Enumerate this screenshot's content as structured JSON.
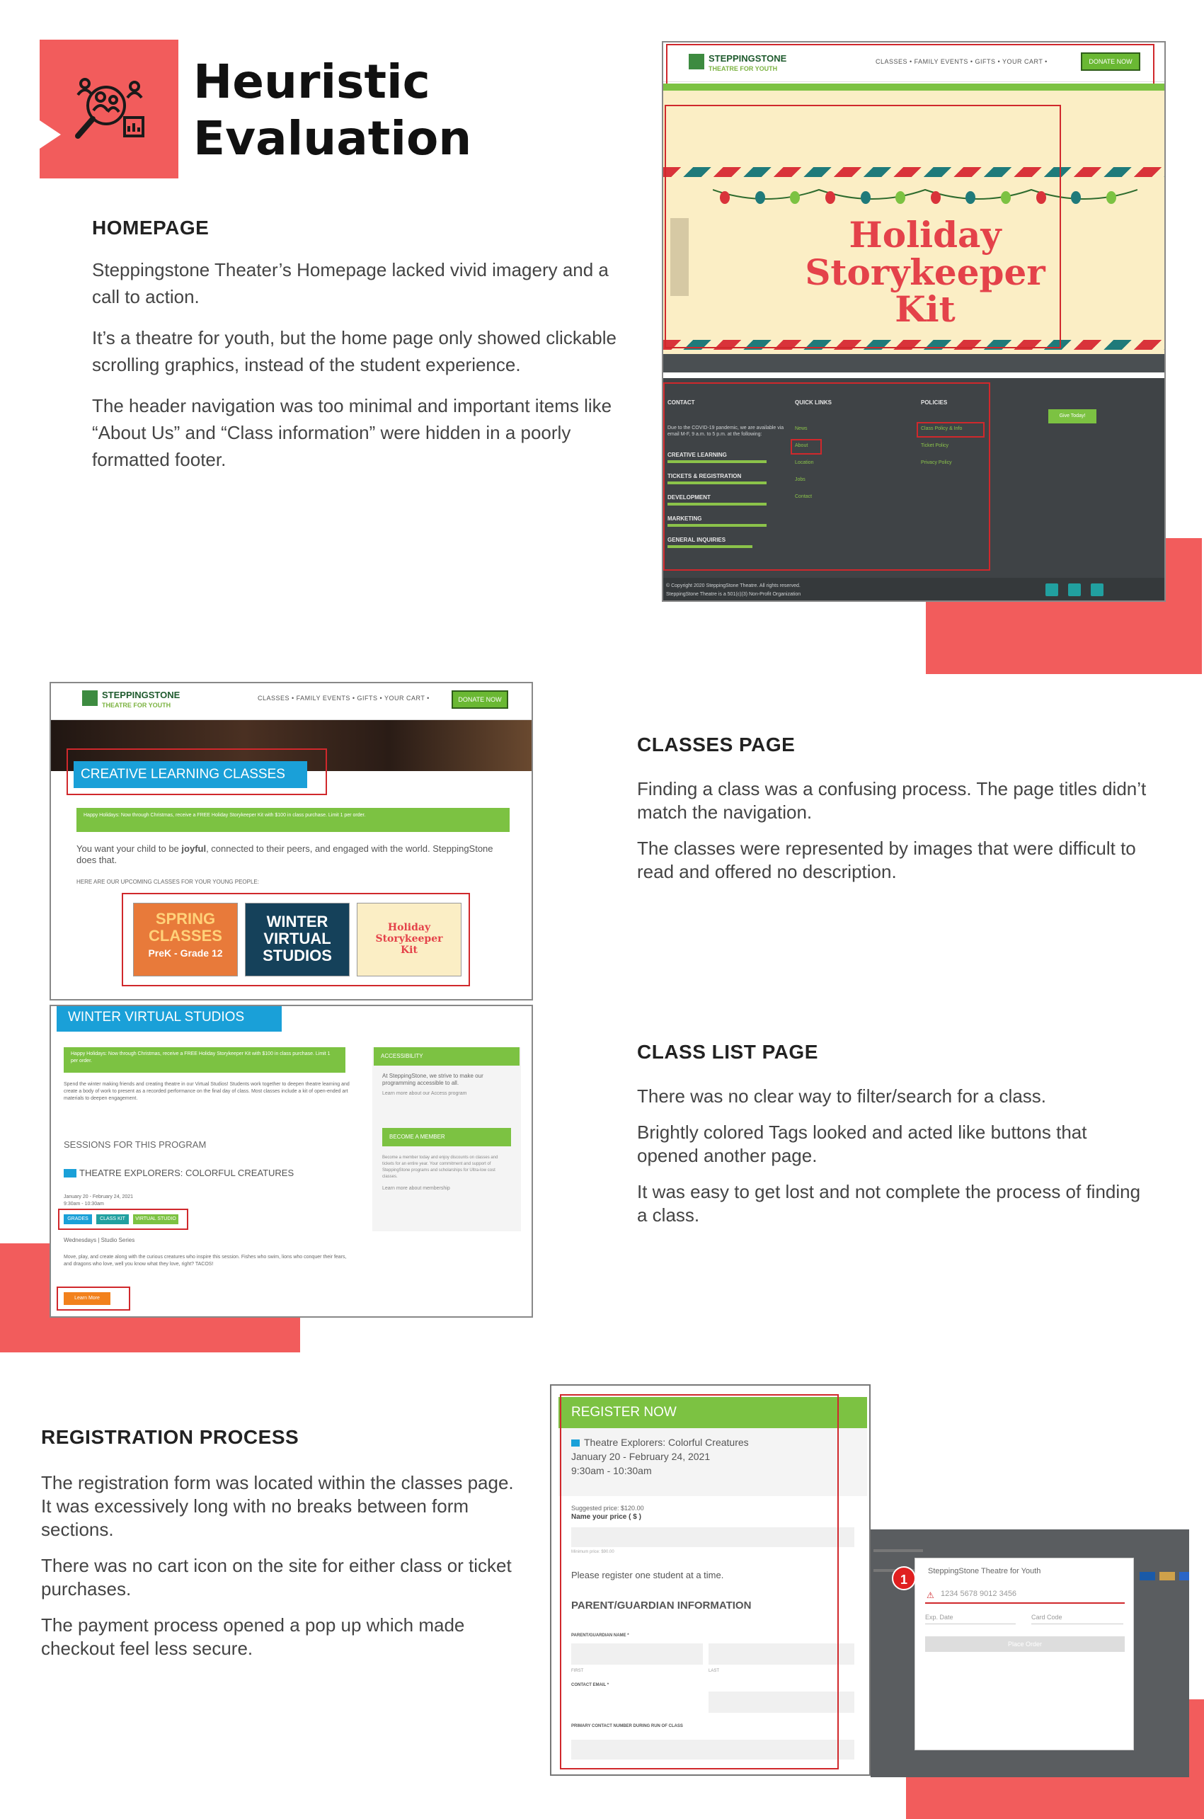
{
  "title": {
    "line1": "Heuristic",
    "line2": "Evaluation",
    "icon": "user-research-magnifier-icon"
  },
  "homepage": {
    "heading": "HOMEPAGE",
    "paragraphs": [
      "Steppingstone Theater’s Homepage lacked vivid imagery and a call to action.",
      "It’s a theatre for youth, but the home page only showed clickable scrolling graphics, instead of the student experience.",
      "The header navigation was too minimal and important items like “About Us” and “Class information” were hidden in a poorly formatted footer."
    ]
  },
  "classes": {
    "heading": "CLASSES PAGE",
    "paragraphs": [
      "Finding a class was a confusing process. The page titles didn’t match the navigation.",
      "The classes were represented by images that were difficult to read and offered no description."
    ]
  },
  "classlist": {
    "heading": "CLASS LIST PAGE",
    "paragraphs": [
      "There was no clear way to filter/search for a class.",
      "Brightly colored Tags looked and acted like buttons that opened another page.",
      "It was easy to get lost and not complete the process of finding a class."
    ]
  },
  "registration": {
    "heading": "REGISTRATION PROCESS",
    "paragraphs": [
      "The registration form was located within the classes page. It was excessively long with no breaks between form sections.",
      "There was no cart icon on the site for either class or ticket purchases.",
      "The payment process opened a pop up which made checkout feel less secure."
    ]
  },
  "site": {
    "logo_line1": "STEPPINGSTONE",
    "logo_line2": "THEATRE FOR YOUTH",
    "nav": "CLASSES •  FAMILY EVENTS •  GIFTS •  YOUR CART •",
    "donate": "DONATE NOW"
  },
  "homeshot": {
    "holiday": [
      "Holiday",
      "Storykeeper",
      "Kit"
    ],
    "footer": {
      "contact": "CONTACT",
      "quick_links": "QUICK LINKS",
      "policies": "POLICIES",
      "contact_lines": [
        "Due to the COVID-19 pandemic, we are available via email M-F, 9 a.m. to 5 p.m. at the following:",
        "CREATIVE LEARNING",
        "TICKETS & REGISTRATION",
        "DEVELOPMENT",
        "MARKETING",
        "GENERAL INQUIRIES"
      ],
      "links": [
        "News",
        "About",
        "Location",
        "Jobs",
        "Contact"
      ],
      "policies_list": [
        "Class Policy & Info",
        "Ticket Policy",
        "Privacy Policy"
      ],
      "cta": "Give Today!",
      "copyright": "© Copyright 2020 SteppingStone Theatre. All rights reserved.",
      "nonprofit": "SteppingStone Theatre is a 501(c)(3) Non-Profit Organization"
    }
  },
  "classesshot": {
    "banner": "CREATIVE LEARNING CLASSES",
    "notice": "Happy Holidays: Now through Christmas, receive a FREE Holiday Storykeeper Kit with $100 in class purchase. Limit 1 per order.",
    "intro_plain": "You want your child to be ",
    "intro_bold": "joyful",
    "intro_rest": ", connected to their peers, and engaged with the world. SteppingStone does that.",
    "upcoming": "HERE ARE OUR UPCOMING CLASSES FOR YOUR YOUNG PEOPLE:",
    "thumbs": [
      {
        "line1": "SPRING",
        "line2": "CLASSES",
        "sub": "PreK - Grade 12"
      },
      {
        "line1": "WINTER",
        "line2": "VIRTUAL",
        "line3": "STUDIOS"
      },
      {
        "line1": "Holiday",
        "line2": "Storykeeper",
        "line3": "Kit"
      }
    ]
  },
  "listshot": {
    "banner": "WINTER VIRTUAL STUDIOS",
    "notice": "Happy Holidays: Now through Christmas, receive a FREE Holiday Storykeeper Kit with $100 in class purchase. Limit 1 per order.",
    "body": "Spend the winter making friends and creating theatre in our Virtual Studios! Students work together to deepen theatre learning and create a body of work to present as a recorded performance on the final day of class. Most classes include a kit of open-ended art materials to deepen engagement.",
    "sessions": "SESSIONS FOR THIS PROGRAM",
    "class_title": "THEATRE EXPLORERS: COLORFUL CREATURES",
    "class_dates": "January 20 - February 24, 2021",
    "class_time": "9:30am - 10:30am",
    "tags": [
      "GRADES",
      "CLASS KIT",
      "VIRTUAL STUDIO"
    ],
    "schedule": "Wednesdays | Studio Series",
    "desc": "Move, play, and create along with the curious creatures who inspire this session. Fishes who swim, lions who conquer their fears, and dragons who love, well you know what they love, right? TACOS!",
    "learn_more": "Learn More",
    "accessibility": "ACCESSIBILITY",
    "access_text": "At SteppingStone, we strive to make our programming accessible to all.",
    "access_link": "Learn more about our Access program",
    "member": "BECOME A MEMBER",
    "member_text": "Become a member today and enjoy discounts on classes and tickets for an entire year. Your commitment and support of SteppingStone programs and scholarships for Ultra-low cost classes.",
    "member_link": "Learn more about membership"
  },
  "regshot": {
    "header": "REGISTER NOW",
    "class_title": "Theatre Explorers: Colorful Creatures",
    "dates": "January 20 - February 24, 2021",
    "time": "9:30am - 10:30am",
    "suggested": "Suggested price: $120.00",
    "name_price": "Name your price ( $ )",
    "minimum": "Minimum price: $90.00",
    "one_student": "Please register one student at a time.",
    "parent_heading": "PARENT/GUARDIAN INFORMATION",
    "parent_name": "PARENT/GUARDIAN NAME *",
    "first": "FIRST",
    "last": "LAST",
    "email": "CONTACT EMAIL *",
    "primary": "PRIMARY CONTACT NUMBER DURING RUN OF CLASS"
  },
  "popup": {
    "merchant": "SteppingStone Theatre for Youth",
    "card_placeholder": "1234 5678 9012 3456",
    "exp": "Exp. Date",
    "cvc": "Card Code",
    "badge": "1",
    "pay": "Place Order"
  }
}
